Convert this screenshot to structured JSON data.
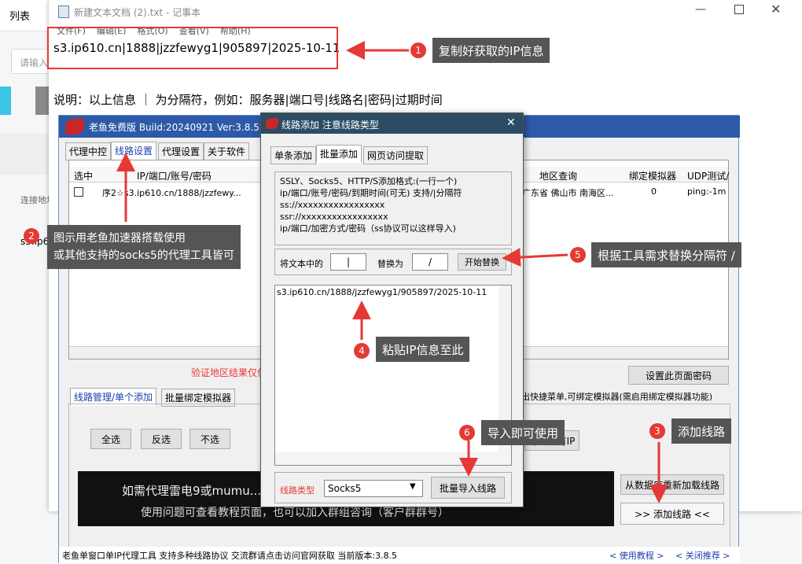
{
  "bg": {
    "title_fragment": "列表",
    "input_placeholder": "请输入",
    "col_label": "连接地址",
    "row_value": "s3.ip6",
    "right_char": "C"
  },
  "notepad": {
    "title": "新建文本文档 (2).txt - 记事本",
    "menu": [
      "文件(F)",
      "编辑(E)",
      "格式(O)",
      "查看(V)",
      "帮助(H)"
    ],
    "line1": "s3.ip610.cn|1888|jzzfewyg1|905897|2025-10-11",
    "description": "说明：以上信息 ｜ 为分隔符，例如：服务器|端口号|线路名|密码|过期时间"
  },
  "main_app": {
    "title": "老鱼免费版 Build:20240921 Ver:3.8.5",
    "tabs": [
      "代理中控",
      "线路设置",
      "代理设置",
      "关于软件"
    ],
    "table_headers": [
      "选中",
      "IP/端口/账号/密码",
      "地区查询",
      "绑定模拟器",
      "UDP测试/"
    ],
    "row": {
      "ip": "序2☆s3.ip610.cn/1888/jzzfewy...",
      "region": "广东省 佛山市 南海区...",
      "binding": "0",
      "udp": "ping:-1m"
    },
    "verify_text": "验证地区结果仅仅",
    "set_password": "设置此页面密码",
    "subtabs": [
      "线路管理/单个添加",
      "批量绑定模拟器"
    ],
    "hint": "出快捷菜单,可绑定模拟器(需启用绑定模拟器功能)",
    "buttons": [
      "全选",
      "反选",
      "不选"
    ],
    "export_btn": "导出所有IP",
    "reload_btn": "从数据库重新加载线路",
    "add_line_btn": ">>  添加线路  <<",
    "banner": [
      "如需代理雷电9或mumu...走流量",
      "使用问题可查看教程页面，也可以加入群组咨询（客户群群号）"
    ],
    "status": "老鱼单窗口单IP代理工具 支持多种线路协议 交流群请点击访问官网获取  当前版本:3.8.5",
    "links": [
      "< 使用教程 >",
      "< 关闭推荐 >"
    ]
  },
  "dialog": {
    "title": "线路添加 注意线路类型",
    "tabs": [
      "单条添加",
      "批量添加",
      "网页访问提取"
    ],
    "format_lines": [
      "SSLY、Socks5、HTTP/S添加格式:(一行一个)",
      "ip/端口/账号/密码/到期时间(可无) 支持/|分隔符",
      "ss://xxxxxxxxxxxxxxxxx",
      "ssr://xxxxxxxxxxxxxxxxx",
      "ip/端口/加密方式/密码（ss协议可以这样导入)"
    ],
    "replace_label": "将文本中的",
    "replace_from": "|",
    "replace_with_label": "替换为",
    "replace_to": "/",
    "replace_btn": "开始替换",
    "textarea_value": "s3.ip610.cn/1888/jzzfewyg1/905897/2025-10-11",
    "type_label": "线路类型",
    "type_value": "Socks5",
    "import_btn": "批量导入线路"
  },
  "callouts": [
    {
      "n": "1",
      "text": "复制好获取的IP信息"
    },
    {
      "n": "2",
      "text": "图示用老鱼加速器搭载使用\n或其他支持的socks5的代理工具皆可"
    },
    {
      "n": "3",
      "text": "添加线路"
    },
    {
      "n": "4",
      "text": "粘贴IP信息至此"
    },
    {
      "n": "5",
      "text": "根据工具需求替换分隔符 /"
    },
    {
      "n": "6",
      "text": "导入即可使用"
    }
  ],
  "colors": {
    "accent_red": "#e53935",
    "callout_bg": "#555555",
    "dialog_title": "#2b4c63",
    "main_title": "#2d5aa8",
    "banner_bg": "#111111"
  }
}
